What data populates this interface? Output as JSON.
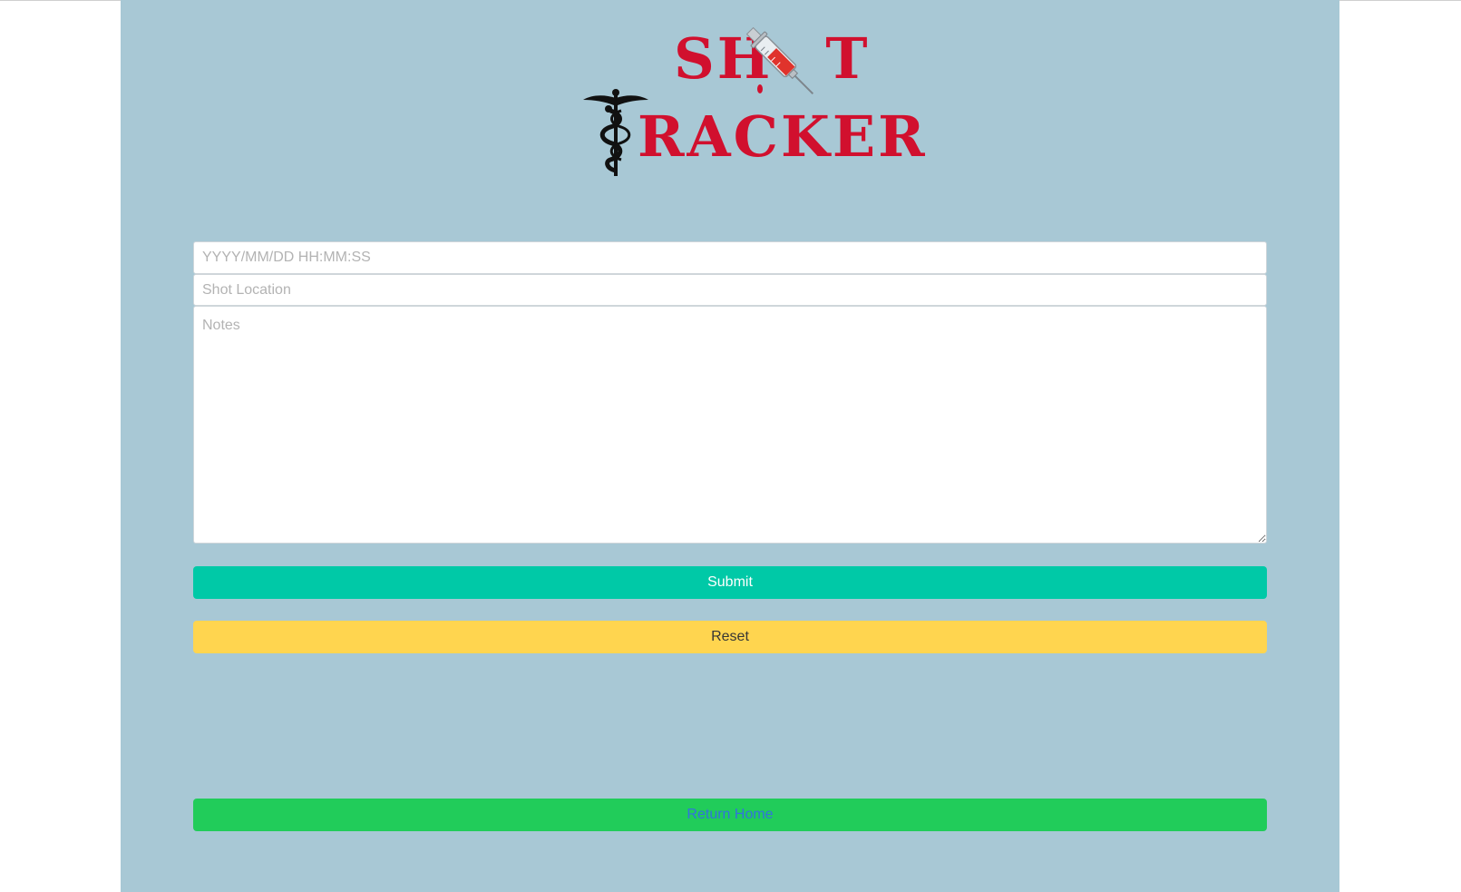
{
  "app": {
    "logo": {
      "line1": "SH",
      "line1_end": "T",
      "line2": "RACKER",
      "brand_color": "#d1102e",
      "icons": [
        "syringe-icon",
        "caduceus-icon"
      ]
    }
  },
  "form": {
    "datetime": {
      "placeholder": "YYYY/MM/DD HH:MM:SS",
      "value": ""
    },
    "location": {
      "placeholder": "Shot Location",
      "value": ""
    },
    "notes": {
      "placeholder": "Notes",
      "value": ""
    },
    "submit_label": "Submit",
    "reset_label": "Reset"
  },
  "nav": {
    "return_home_label": "Return Home"
  },
  "colors": {
    "panel_bg": "#a8c8d5",
    "submit_bg": "#00c9a7",
    "reset_bg": "#ffd54f",
    "home_bg": "#21cc5a",
    "home_text": "#3273dc"
  }
}
